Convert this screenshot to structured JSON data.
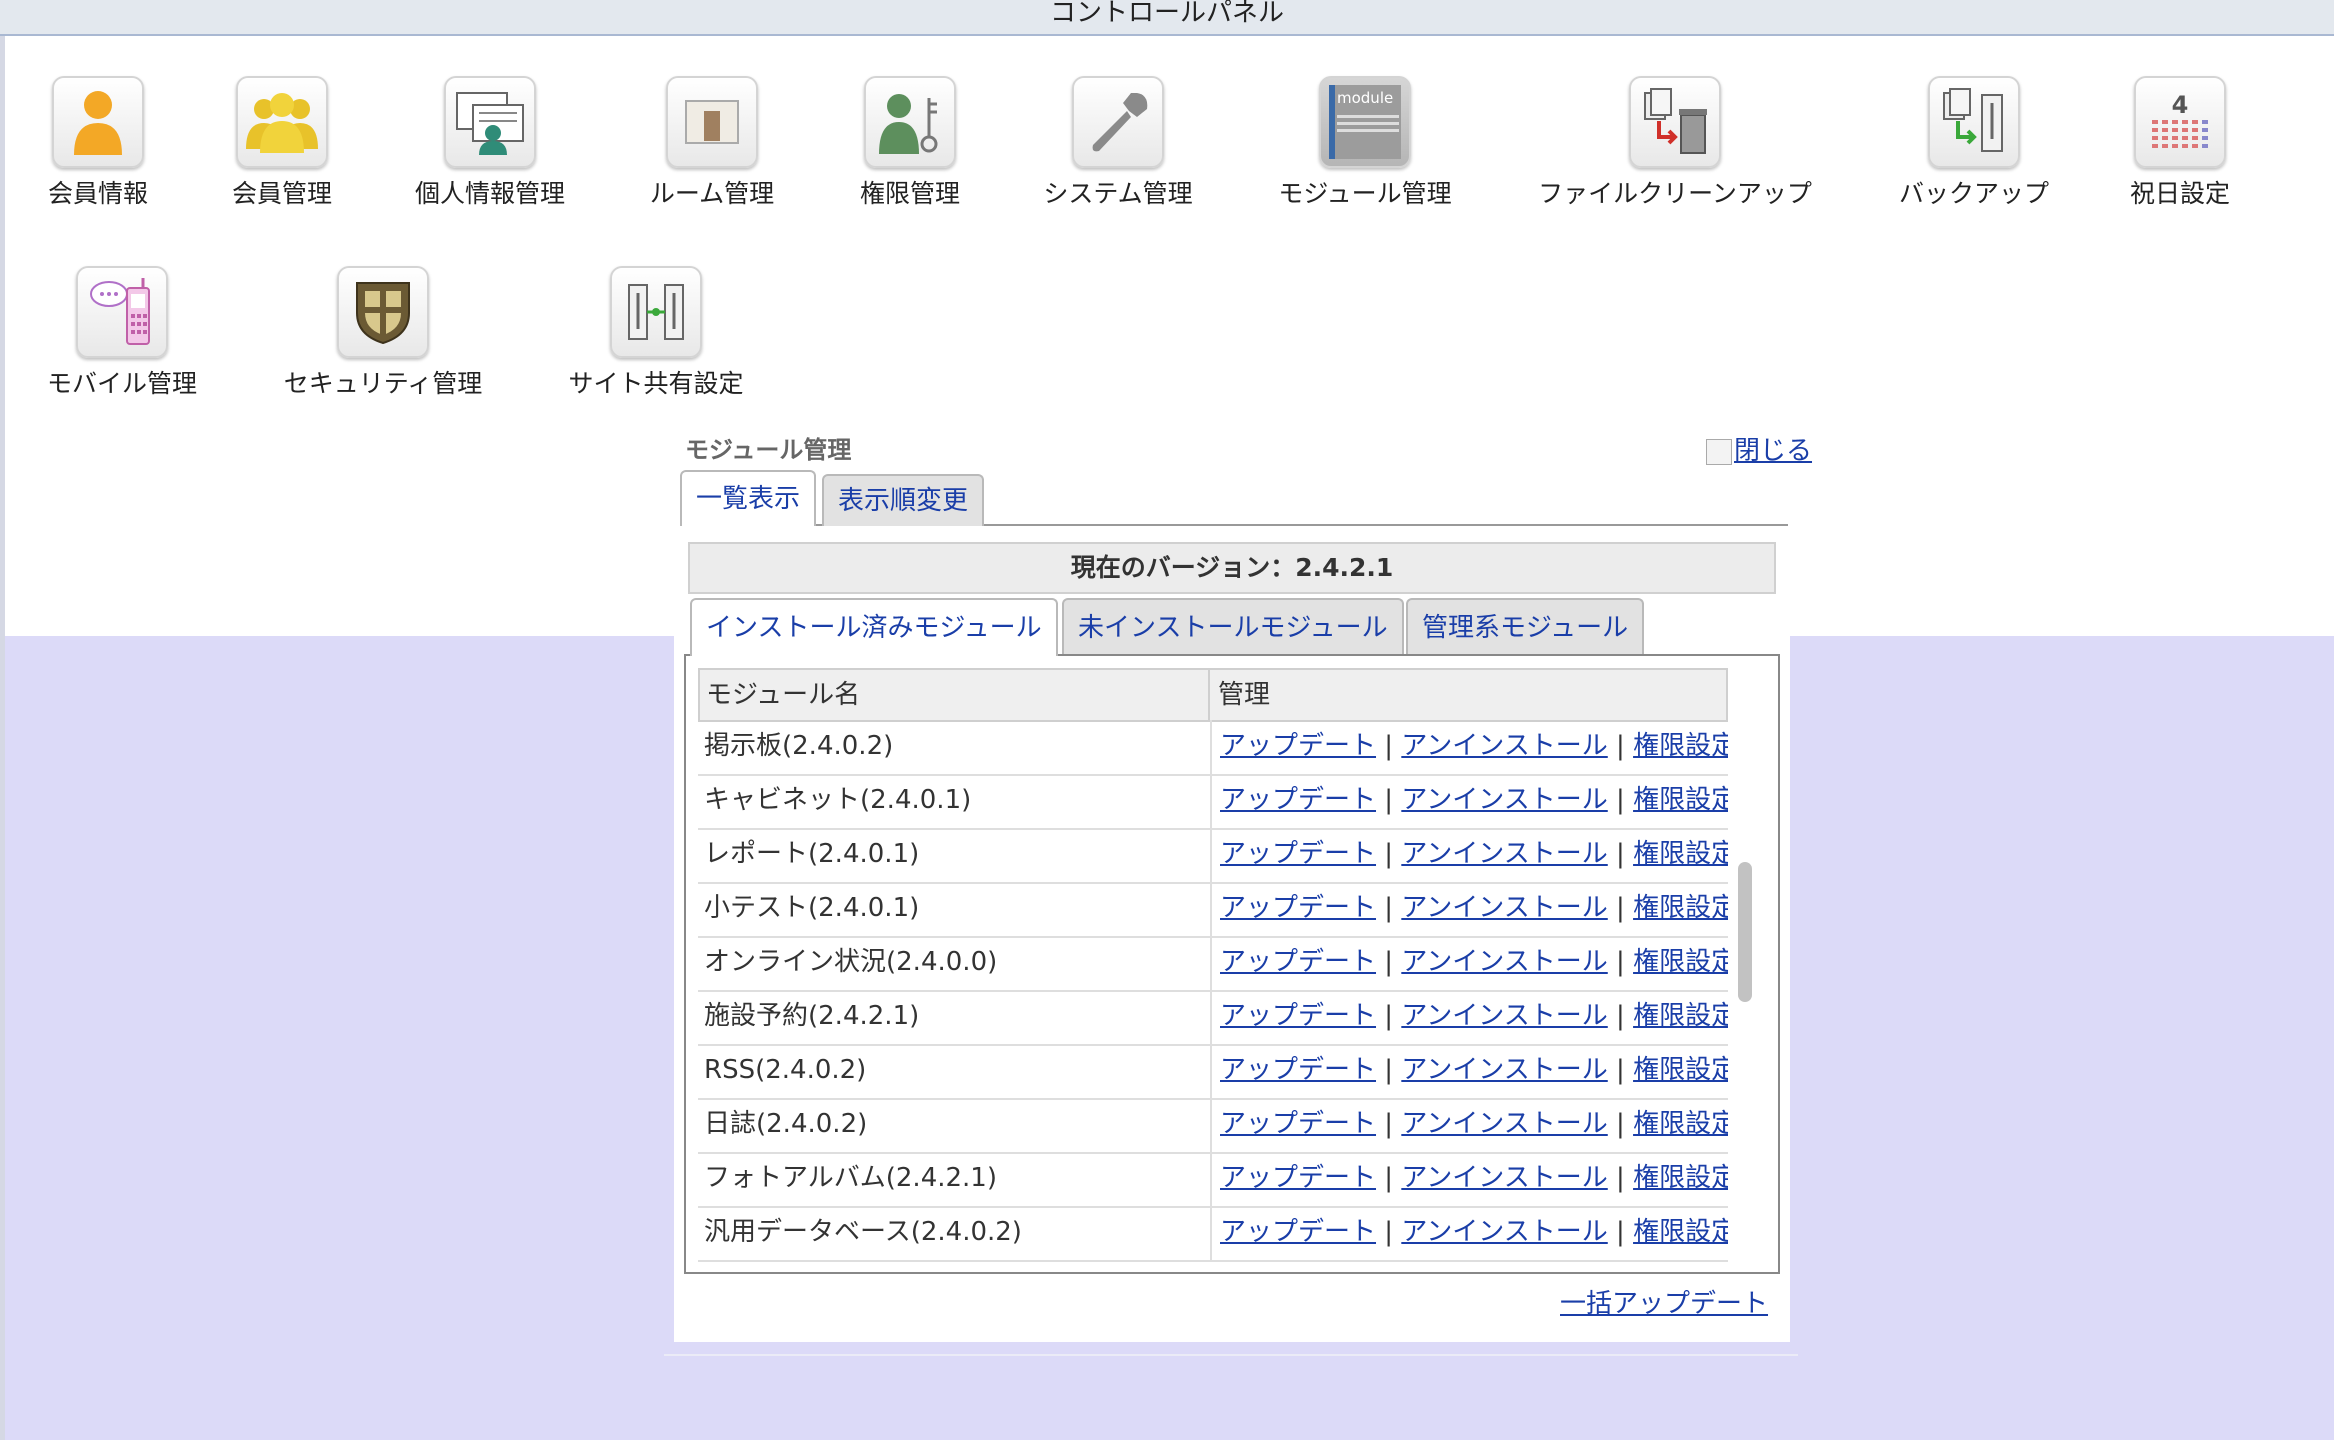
{
  "header": {
    "title": "コントロールパネル"
  },
  "icons": [
    {
      "label": "会員情報",
      "icon": "user-icon"
    },
    {
      "label": "会員管理",
      "icon": "users-icon"
    },
    {
      "label": "個人情報管理",
      "icon": "personal-info-icon"
    },
    {
      "label": "ルーム管理",
      "icon": "room-icon"
    },
    {
      "label": "権限管理",
      "icon": "permission-key-icon"
    },
    {
      "label": "システム管理",
      "icon": "wrench-icon"
    },
    {
      "label": "モジュール管理",
      "icon": "module-icon",
      "icon_text": "module"
    },
    {
      "label": "ファイルクリーンアップ",
      "icon": "file-cleanup-trash-icon"
    },
    {
      "label": "バックアップ",
      "icon": "backup-icon"
    },
    {
      "label": "祝日設定",
      "icon": "calendar-icon",
      "icon_text": "4"
    },
    {
      "label": "モバイル管理",
      "icon": "mobile-phone-icon"
    },
    {
      "label": "セキュリティ管理",
      "icon": "shield-icon"
    },
    {
      "label": "サイト共有設定",
      "icon": "site-share-icon"
    }
  ],
  "module_panel": {
    "title": "モジュール管理",
    "close_label": "閉じる",
    "tabs": [
      "一覧表示",
      "表示順変更"
    ],
    "version_text": "現在のバージョン：2.4.2.1",
    "subtabs": [
      "インストール済みモジュール",
      "未インストールモジュール",
      "管理系モジュール"
    ],
    "table": {
      "headers": [
        "モジュール名",
        "管理"
      ],
      "rows": [
        "掲示板(2.4.0.2)",
        "キャビネット(2.4.0.1)",
        "レポート(2.4.0.1)",
        "小テスト(2.4.0.1)",
        "オンライン状況(2.4.0.0)",
        "施設予約(2.4.2.1)",
        "RSS(2.4.0.2)",
        "日誌(2.4.0.2)",
        "フォトアルバム(2.4.2.1)",
        "汎用データベース(2.4.0.2)"
      ],
      "actions": {
        "update": "アップデート",
        "uninstall": "アンインストール",
        "permission": "権限設定",
        "separator": "|"
      }
    },
    "bulk_update_label": "一括アップデート"
  },
  "colors": {
    "link": "#1a3ea8",
    "background_lower": "#dcdaf8",
    "titlebar": "#e3e8ee"
  }
}
